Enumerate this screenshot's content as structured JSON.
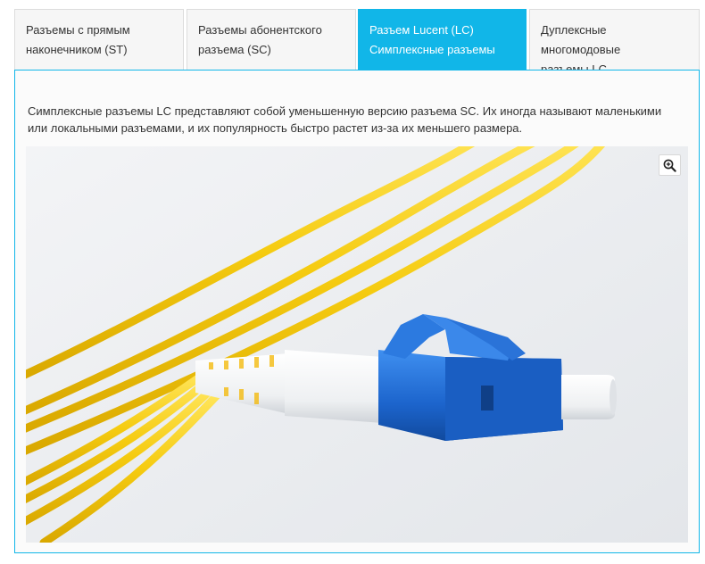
{
  "tabs": [
    {
      "label_line1": "Разъемы с прямым",
      "label_line2": "наконечником (ST)",
      "active": false
    },
    {
      "label_line1": "Разъемы абонентского",
      "label_line2": "разъема (SC)",
      "active": false
    },
    {
      "label_line1": "Разъем Lucent (LC)",
      "label_line2": "Симплексные разъемы",
      "active": true
    },
    {
      "label_line1": "Дуплексные многомодовые",
      "label_line2": "разъемы LC",
      "active": false
    }
  ],
  "panel": {
    "description": "Симплексные разъемы LC представляют собой уменьшенную версию разъема SC. Их иногда называют маленькими или локальными разъемами, и их популярность быстро растет из-за их меньшего размера.",
    "image_icon": "zoom-in-icon"
  },
  "colors": {
    "accent": "#11b6e8",
    "cable": "#f7d21a",
    "connector": "#1f6fd0"
  }
}
